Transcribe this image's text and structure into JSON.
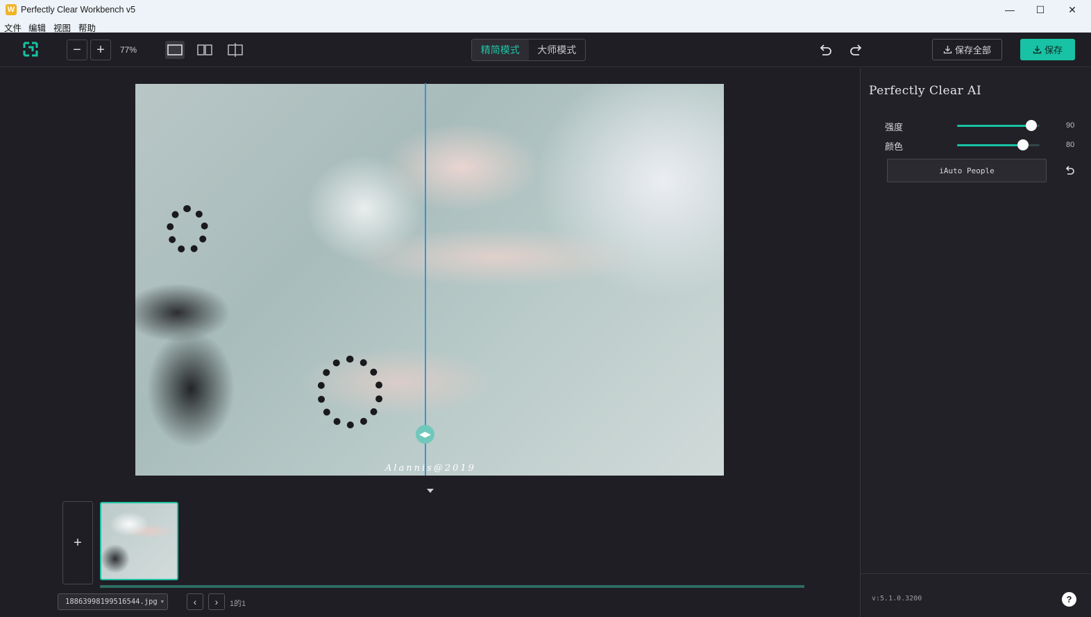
{
  "window": {
    "title": "Perfectly Clear Workbench v5",
    "app_icon_glyph": "W",
    "minimize_glyph": "—",
    "maximize_glyph": "☐",
    "close_glyph": "✕"
  },
  "menu": [
    "文件",
    "编辑",
    "视图",
    "帮助"
  ],
  "toolbar": {
    "zoom_out": "−",
    "zoom_in": "+",
    "zoom_level": "77%",
    "modes": [
      {
        "label": "精简模式",
        "active": true
      },
      {
        "label": "大师模式",
        "active": false
      }
    ],
    "save_all_label": "保存全部",
    "save_label": "保存",
    "accent_color": "#18c2a4"
  },
  "canvas": {
    "watermark": "Alannis@2019",
    "compare_handle_glyph": "◀▶"
  },
  "filmstrip": {
    "add_glyph": "+",
    "file_name": "18863998199516544.jpg",
    "prev_glyph": "‹",
    "next_glyph": "›",
    "page_label": "1的1",
    "progress": 1.0
  },
  "panel": {
    "title": "Perfectly Clear AI",
    "sliders": [
      {
        "label": "强度",
        "value": "90",
        "fraction": 0.9
      },
      {
        "label": "颜色",
        "value": "80",
        "fraction": 0.8
      }
    ],
    "preset_label": "iAuto People",
    "version": "v:5.1.0.3200",
    "help_glyph": "?"
  }
}
